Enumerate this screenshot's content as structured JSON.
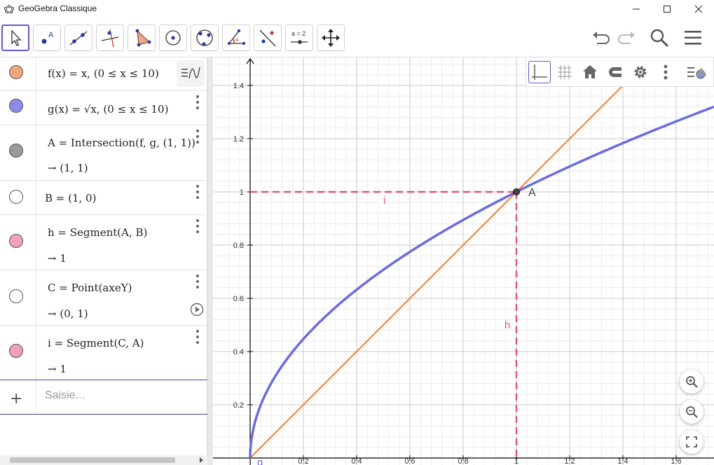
{
  "window": {
    "title": "GeoGebra Classique"
  },
  "toolbar": {
    "tools": [
      {
        "name": "move-tool",
        "icon": "arrow-pointer-icon"
      },
      {
        "name": "point-tool",
        "icon": "point-icon",
        "label": "A"
      },
      {
        "name": "line-tool",
        "icon": "line-icon"
      },
      {
        "name": "perpendicular-line-tool",
        "icon": "perpendicular-icon"
      },
      {
        "name": "polygon-tool",
        "icon": "polygon-icon"
      },
      {
        "name": "circle-tool",
        "icon": "circle-center-icon"
      },
      {
        "name": "circle-three-points-tool",
        "icon": "circle-points-icon"
      },
      {
        "name": "angle-tool",
        "icon": "angle-icon"
      },
      {
        "name": "reflect-tool",
        "icon": "reflect-icon"
      },
      {
        "name": "slider-tool",
        "icon": "slider-icon",
        "label": "a = 2"
      },
      {
        "name": "move-graphics-tool",
        "icon": "move-arrows-icon"
      }
    ],
    "undo_icon": "undo-icon",
    "redo_icon": "redo-icon",
    "search_icon": "search-icon",
    "menu_icon": "hamburger-menu-icon"
  },
  "algebra": {
    "rows": [
      {
        "definition": "f(x) = x,  (0 ≤ x ≤ 10)",
        "output": "",
        "color": "#f0a77c",
        "filled": true
      },
      {
        "definition": "g(x) = √x,  (0 ≤ x ≤ 10)",
        "output": "",
        "color": "#8c8ce8",
        "filled": true
      },
      {
        "definition": "A = Intersection(f, g, (1, 1))",
        "output": "→  (1, 1)",
        "color": "#9a9a9a",
        "filled": true
      },
      {
        "definition": "B = (1, 0)",
        "output": "",
        "color": "#ffffff",
        "filled": false
      },
      {
        "definition": "h = Segment(A, B)",
        "output": "→  1",
        "color": "#f4a0b8",
        "filled": true
      },
      {
        "definition": "C = Point(axeY)",
        "output": "→  (0, 1)",
        "color": "#ffffff",
        "filled": false
      },
      {
        "definition": "i = Segment(C, A)",
        "output": "→  1",
        "color": "#f4a0b8",
        "filled": true
      }
    ],
    "input_placeholder": "Saisie..."
  },
  "graphics": {
    "axis_color": "#000000",
    "f_color": "#f08a3c",
    "g_color": "#6b6be0",
    "segment_color": "#e05578",
    "point_labels": {
      "A": "A"
    },
    "segment_labels": {
      "h": "h",
      "i": "i"
    },
    "function_labels": {
      "g": "g"
    },
    "x_ticks": [
      "0.2",
      "0.4",
      "0.6",
      "0.8",
      "1",
      "1.2",
      "1.4",
      "1.6"
    ],
    "y_ticks": [
      "0.2",
      "0.4",
      "0.6",
      "0.8",
      "1",
      "1.2",
      "1.4"
    ]
  }
}
